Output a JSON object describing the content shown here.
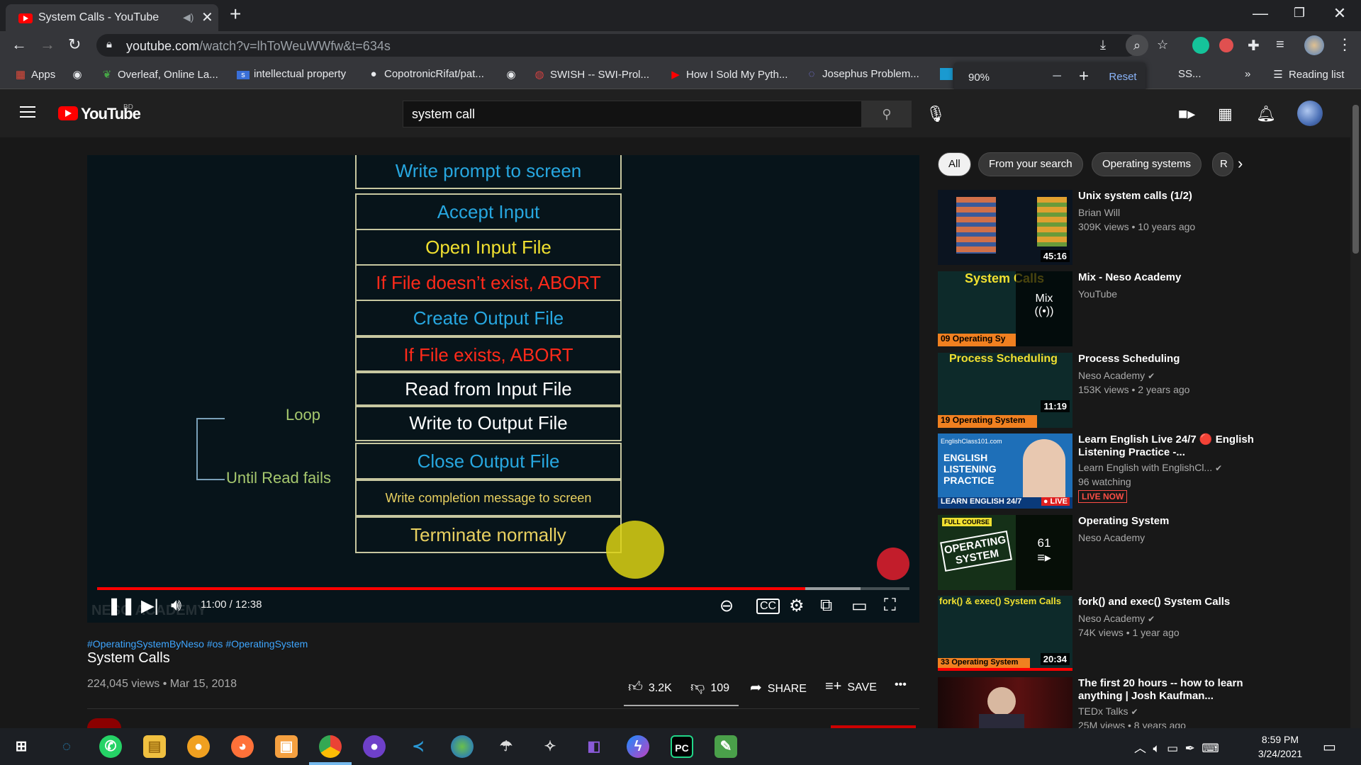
{
  "browser": {
    "tab_title": "System Calls - YouTube",
    "url_host": "youtube.com",
    "url_path": "/watch?v=lhToWeuWWfw&t=634s",
    "zoom_level": "90%",
    "zoom_reset": "Reset",
    "reading_list": "Reading list",
    "bookmarks": [
      "Apps",
      "Overleaf, Online La...",
      "intellectual property",
      "CopotronicRifat/pat...",
      "SWISH -- SWI-Prol...",
      "How I Sold My Pyth...",
      "Josephus Problem...",
      "SS..."
    ]
  },
  "youtube": {
    "country": "BD",
    "search_query": "system call"
  },
  "video": {
    "slide_boxes": [
      {
        "text": "Write prompt to screen",
        "color": "#27a7e0"
      },
      {
        "text": "Accept Input",
        "color": "#27a7e0"
      },
      {
        "text": "Open Input File",
        "color": "#f0e030"
      },
      {
        "text": "If File doesn’t exist, ABORT",
        "color": "#ff2a1a"
      },
      {
        "text": "Create Output File",
        "color": "#27a7e0"
      },
      {
        "text": "If File exists, ABORT",
        "color": "#ff2a1a"
      },
      {
        "text": "Read from Input File",
        "color": "#ffffff"
      },
      {
        "text": "Write to Output File",
        "color": "#ffffff"
      },
      {
        "text": "Close Output File",
        "color": "#27a7e0"
      },
      {
        "text": "Write completion message to screen",
        "color": "#e8d060"
      },
      {
        "text": "Terminate normally",
        "color": "#e8d060"
      }
    ],
    "loop_label": "Loop",
    "until_label": "Until Read fails",
    "watermark": "NESO ACADEMY",
    "time": "11:00 / 12:38",
    "progress": 0.872,
    "buffered": 0.94
  },
  "meta": {
    "tags": "#OperatingSystemByNeso #os #OperatingSystem",
    "title": "System Calls",
    "views": "224,045 views • Mar 15, 2018",
    "likes": "3.2K",
    "dislikes": "109",
    "share": "SHARE",
    "save": "SAVE"
  },
  "chips": [
    "All",
    "From your search",
    "Operating systems",
    "R"
  ],
  "recommendations": [
    {
      "title": "Unix system calls (1/2)",
      "channel": "Brian Will",
      "meta": "309K views • 10 years ago",
      "duration": "45:16",
      "verified": false
    },
    {
      "title": "Mix - Neso Academy",
      "channel": "YouTube",
      "meta": "",
      "duration": "",
      "badge": "Mix",
      "thumb_text": "System Calls",
      "thumb_num": "09",
      "thumb_sub": "Operating Sy",
      "verified": false
    },
    {
      "title": "Process Scheduling",
      "channel": "Neso Academy",
      "meta": "153K views • 2 years ago",
      "duration": "11:19",
      "thumb_text": "Process Scheduling",
      "thumb_num": "19",
      "thumb_sub": "Operating System",
      "verified": true
    },
    {
      "title": "Learn English Live 24/7 🔴 English Listening Practice -...",
      "channel": "Learn English with EnglishCl...",
      "meta": "96 watching",
      "live": "LIVE NOW",
      "thumb_text": "ENGLISH LISTENING PRACTICE",
      "thumb_sub": "LEARN ENGLISH 24/7",
      "thumb_top": "EnglishClass101.com",
      "thumb_live": "● LIVE",
      "verified": true
    },
    {
      "title": "Operating System",
      "channel": "Neso Academy",
      "meta": "",
      "playlist_count": "61",
      "thumb_text": "OPERATING SYSTEM",
      "thumb_top": "FULL COURSE",
      "verified": false
    },
    {
      "title": "fork() and exec() System Calls",
      "channel": "Neso Academy",
      "meta": "74K views • 1 year ago",
      "duration": "20:34",
      "thumb_text": "fork() & exec() System Calls",
      "thumb_num": "33",
      "thumb_sub": "Operating System",
      "verified": true
    },
    {
      "title": "The first 20 hours -- how to learn anything | Josh Kaufman...",
      "channel": "TEDx Talks",
      "meta": "25M views • 8 years ago",
      "duration": "",
      "verified": true
    }
  ],
  "taskbar": {
    "time": "8:59 PM",
    "date": "3/24/2021"
  },
  "colors": {
    "yt_red": "#ff0000",
    "link_blue": "#3ea6ff",
    "chrome_dark": "#202124"
  }
}
